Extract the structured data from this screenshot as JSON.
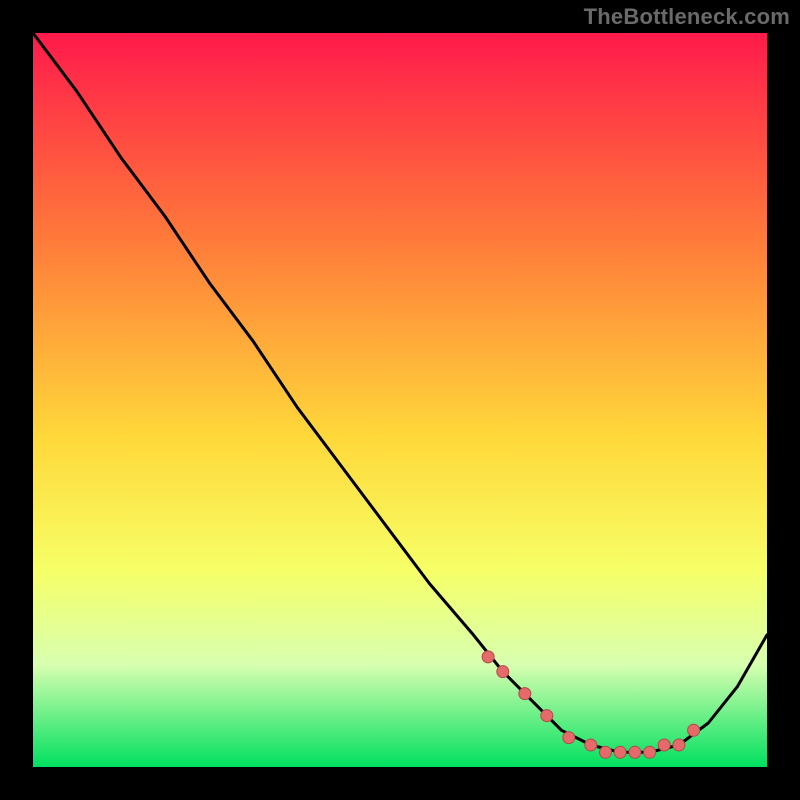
{
  "attribution": "TheBottleneck.com",
  "colors": {
    "background": "#000000",
    "gradient_top": "#ff1a4b",
    "gradient_upper_mid": "#ff7a3a",
    "gradient_mid": "#ffd83a",
    "gradient_lower_mid": "#f6ff66",
    "gradient_low": "#d8ffb0",
    "gradient_bottom": "#00e060",
    "curve_stroke": "#000000",
    "marker_fill": "#e66a6a",
    "marker_stroke": "#b14a4a"
  },
  "chart_data": {
    "type": "line",
    "title": "",
    "xlabel": "",
    "ylabel": "",
    "xlim": [
      0,
      100
    ],
    "ylim": [
      0,
      100
    ],
    "gradient_stops": [
      {
        "offset": 0,
        "color": "#ff1a4b"
      },
      {
        "offset": 28,
        "color": "#ff7a3a"
      },
      {
        "offset": 55,
        "color": "#ffd83a"
      },
      {
        "offset": 73,
        "color": "#f6ff66"
      },
      {
        "offset": 86,
        "color": "#d8ffb0"
      },
      {
        "offset": 100,
        "color": "#00e060"
      }
    ],
    "series": [
      {
        "name": "bottleneck-curve",
        "x": [
          0,
          6,
          12,
          18,
          24,
          30,
          36,
          42,
          48,
          54,
          60,
          64,
          68,
          72,
          76,
          80,
          84,
          88,
          92,
          96,
          100
        ],
        "y": [
          100,
          92,
          83,
          75,
          66,
          58,
          49,
          41,
          33,
          25,
          18,
          13,
          9,
          5,
          3,
          2,
          2,
          3,
          6,
          11,
          18
        ]
      }
    ],
    "markers": {
      "name": "highlighted-points",
      "x": [
        62,
        64,
        67,
        70,
        73,
        76,
        78,
        80,
        82,
        84,
        86,
        88,
        90
      ],
      "y": [
        15,
        13,
        10,
        7,
        4,
        3,
        2,
        2,
        2,
        2,
        3,
        3,
        5
      ]
    }
  }
}
